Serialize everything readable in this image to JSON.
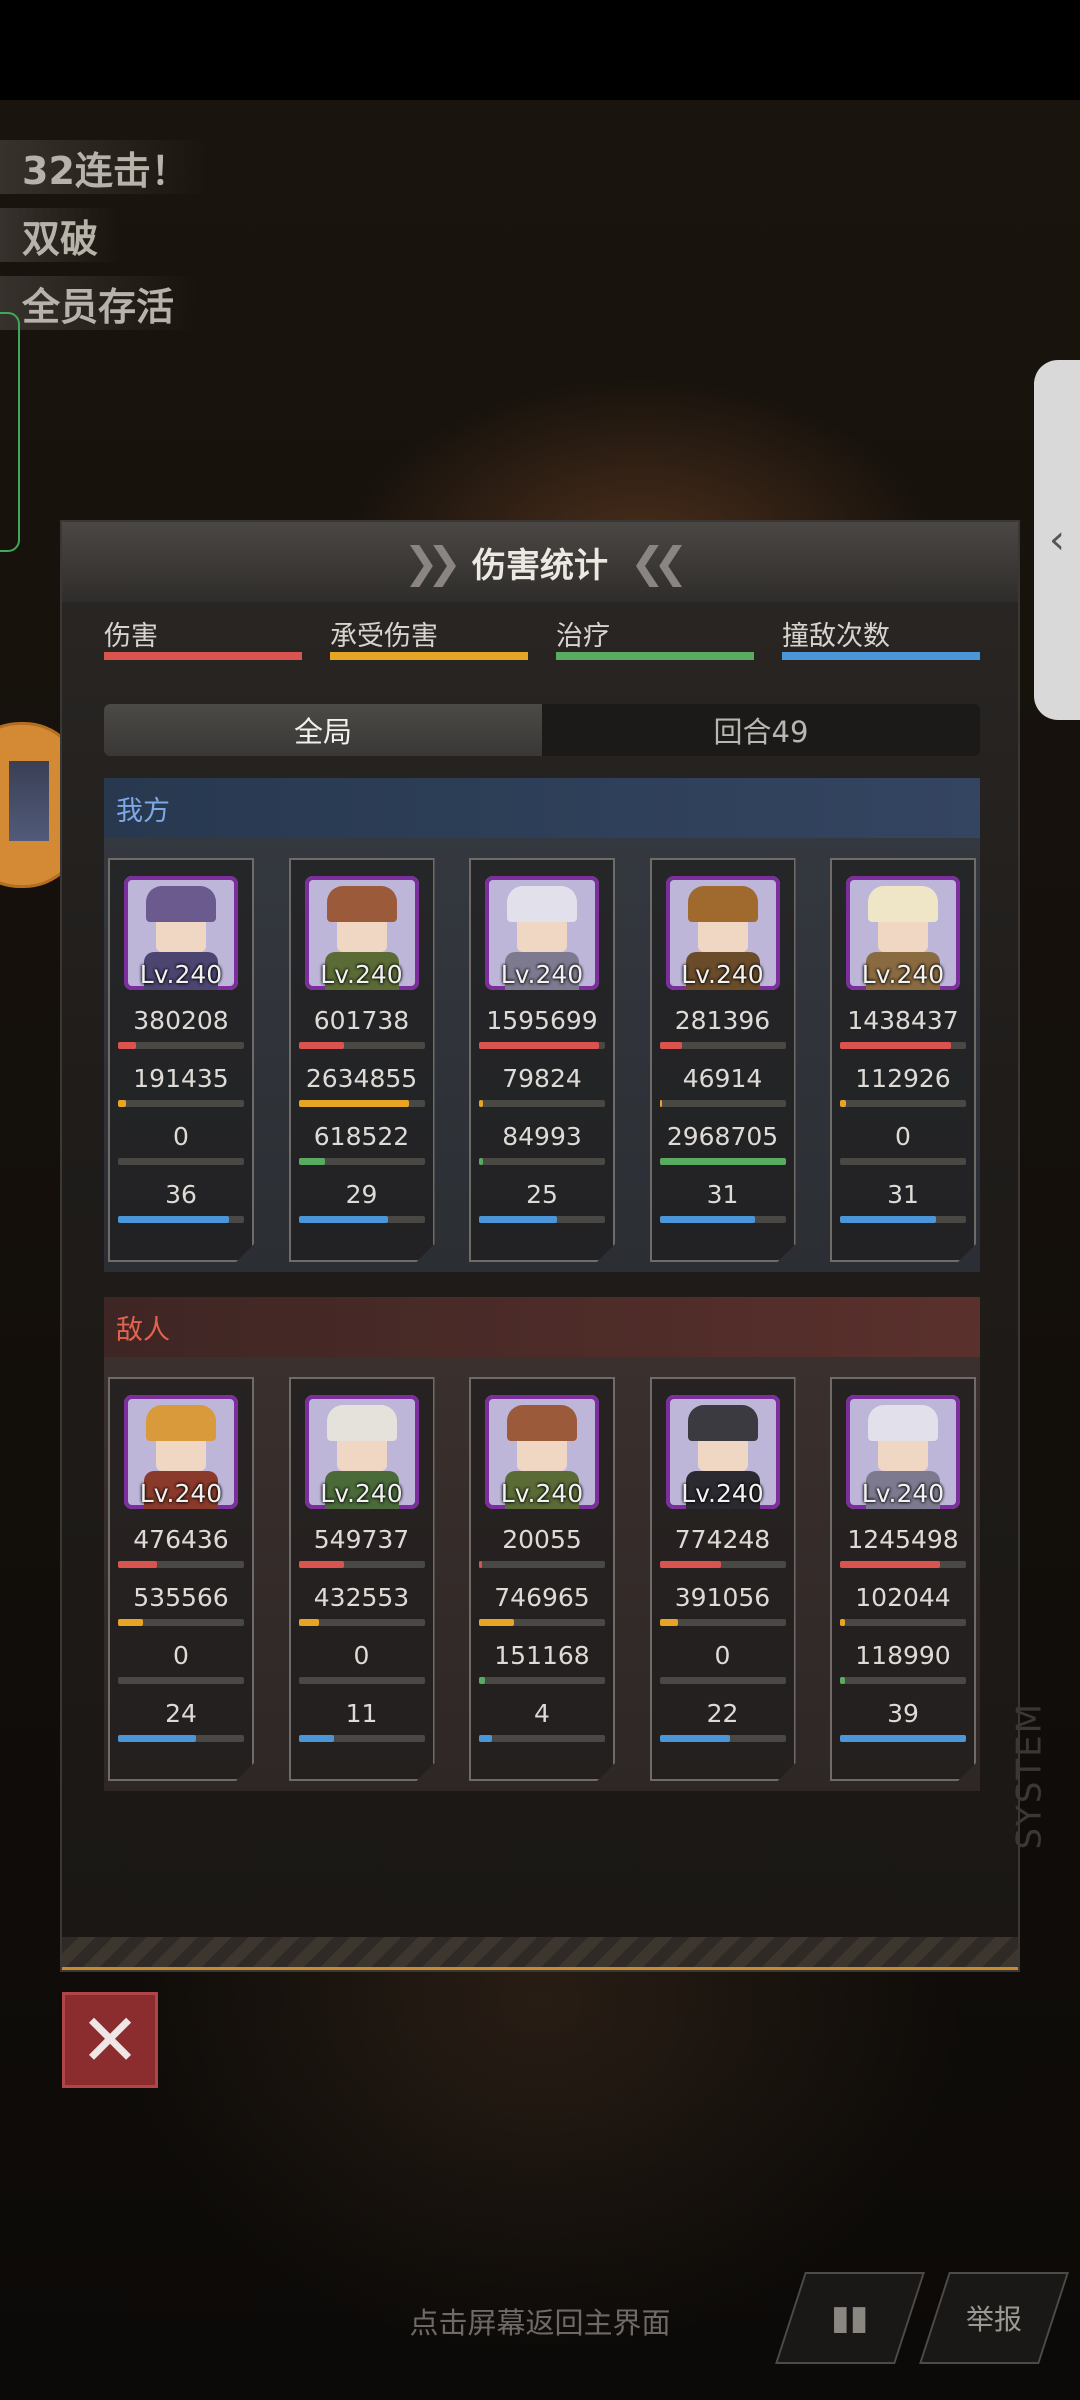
{
  "banners": [
    "32连击！",
    "双破",
    "全员存活"
  ],
  "panel": {
    "title": "伤害统计",
    "legend": [
      {
        "label": "伤害",
        "color": "#d9534f"
      },
      {
        "label": "承受伤害",
        "color": "#e6a524"
      },
      {
        "label": "治疗",
        "color": "#5aab62"
      },
      {
        "label": "撞敌次数",
        "color": "#4a96d8"
      }
    ],
    "tabs": [
      {
        "label": "全局",
        "active": true
      },
      {
        "label": "回合49",
        "active": false
      }
    ],
    "ally": {
      "label": "我方",
      "units": [
        {
          "level": "Lv.240",
          "damage": "380208",
          "taken": "191435",
          "heal": "0",
          "hits": "36",
          "fill": [
            0.14,
            0.06,
            0.0,
            0.88
          ],
          "hair": "#6a5a8e",
          "outfit": "#4c4570"
        },
        {
          "level": "Lv.240",
          "damage": "601738",
          "taken": "2634855",
          "heal": "618522",
          "hits": "29",
          "fill": [
            0.36,
            0.88,
            0.21,
            0.71
          ],
          "hair": "#9b5a3a",
          "outfit": "#5b6b36"
        },
        {
          "level": "Lv.240",
          "damage": "1595699",
          "taken": "79824",
          "heal": "84993",
          "hits": "25",
          "fill": [
            0.95,
            0.03,
            0.03,
            0.62
          ],
          "hair": "#e2e0ea",
          "outfit": "#7d7a90"
        },
        {
          "level": "Lv.240",
          "damage": "281396",
          "taken": "46914",
          "heal": "2968705",
          "hits": "31",
          "fill": [
            0.18,
            0.02,
            1.0,
            0.76
          ],
          "hair": "#a06a2e",
          "outfit": "#6a4c2a"
        },
        {
          "level": "Lv.240",
          "damage": "1438437",
          "taken": "112926",
          "heal": "0",
          "hits": "31",
          "fill": [
            0.88,
            0.05,
            0.0,
            0.76
          ],
          "hair": "#efe6c8",
          "outfit": "#8a6a40"
        }
      ]
    },
    "enemy": {
      "label": "敌人",
      "units": [
        {
          "level": "Lv.240",
          "damage": "476436",
          "taken": "535566",
          "heal": "0",
          "hits": "24",
          "fill": [
            0.31,
            0.2,
            0.0,
            0.62
          ],
          "hair": "#d89a3a",
          "outfit": "#8a3a2a"
        },
        {
          "level": "Lv.240",
          "damage": "549737",
          "taken": "432553",
          "heal": "0",
          "hits": "11",
          "fill": [
            0.36,
            0.16,
            0.0,
            0.28
          ],
          "hair": "#e4e2da",
          "outfit": "#4a6a3a"
        },
        {
          "level": "Lv.240",
          "damage": "20055",
          "taken": "746965",
          "heal": "151168",
          "hits": "4",
          "fill": [
            0.02,
            0.28,
            0.05,
            0.1
          ],
          "hair": "#9b5a3a",
          "outfit": "#5b6b36"
        },
        {
          "level": "Lv.240",
          "damage": "774248",
          "taken": "391056",
          "heal": "0",
          "hits": "22",
          "fill": [
            0.49,
            0.15,
            0.0,
            0.56
          ],
          "hair": "#3a3a40",
          "outfit": "#2a2a30"
        },
        {
          "level": "Lv.240",
          "damage": "1245498",
          "taken": "102044",
          "heal": "118990",
          "hits": "39",
          "fill": [
            0.79,
            0.04,
            0.04,
            1.0
          ],
          "hair": "#e2e0ea",
          "outfit": "#7d7a90"
        }
      ]
    }
  },
  "bottom": {
    "hint": "点击屏幕返回主界面",
    "report_label": "举报"
  }
}
